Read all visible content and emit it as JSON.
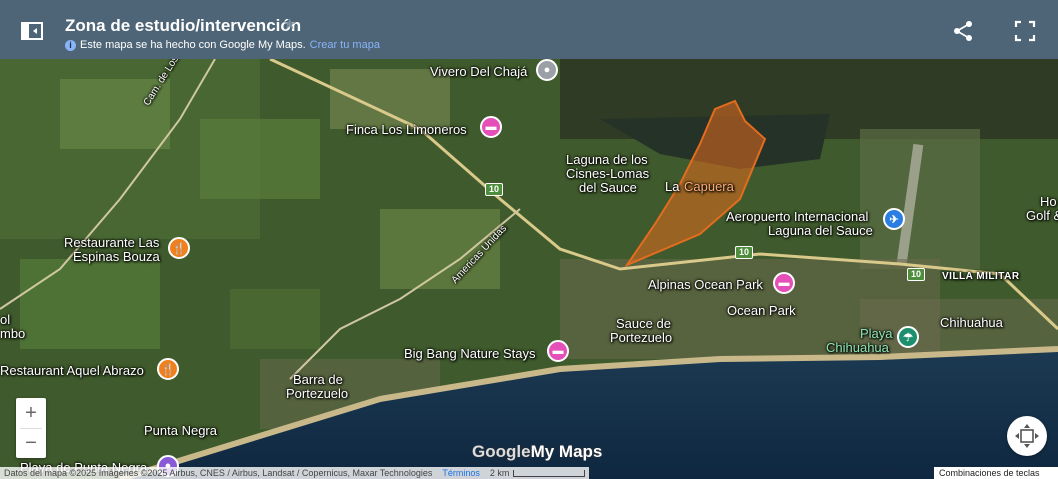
{
  "header": {
    "title": "Zona de estudio/intervención",
    "subtitle": "Este mapa se ha hecho con Google My Maps.",
    "create_link": "Crear tu mapa"
  },
  "places": {
    "vivero": "Vivero Del Chajá",
    "finca": "Finca Los Limoneros",
    "laguna_line1": "Laguna de los",
    "laguna_line2": "Cisnes-Lomas",
    "laguna_line3": "del Sauce",
    "la": "La",
    "capuera": "Capuera",
    "aero_line1": "Aeropuerto Internacional",
    "aero_line2": "Laguna del Sauce",
    "ho_line1": "Ho",
    "ho_line2": "Golf &",
    "villa_militar": "VILLA MILITAR",
    "alpinas": "Alpinas Ocean Park",
    "ocean_park": "Ocean Park",
    "sauce_line1": "Sauce de",
    "sauce_line2": "Portezuelo",
    "playa_line1": "Playa",
    "playa_line2": "Chihuahua",
    "chihuahua": "Chihuahua",
    "restaurante_las_line1": "Restaurante Las",
    "restaurante_las_line2": "Espinas Bouza",
    "big_bang": "Big Bang Nature Stays",
    "restaurant_aquel": "Restaurant Aquel Abrazo",
    "barra_line1": "Barra de",
    "barra_line2": "Portezuelo",
    "punta_negra": "Punta Negra",
    "playa_punta_negra": "Playa de Punta Negra",
    "cam_arrayanes": "Cam. de Los Arrayanes",
    "americas_unidas": "Americas Unidas",
    "left_line1": "ol",
    "left_line2": "mbo",
    "route_10": "10"
  },
  "attribution": {
    "data": "Datos del mapa ©2025 Imágenes ©2025 Airbus, CNES / Airbus, Landsat / Copernicus, Maxar Technologies",
    "terms": "Términos",
    "scale": "2 km",
    "keys": "Combinaciones de teclas"
  },
  "logo": {
    "google": "Google",
    "mymaps": "My Maps"
  },
  "zoom": {
    "in": "+",
    "out": "−"
  },
  "icons": [
    "sidebar-toggle-icon",
    "star-icon",
    "info-icon",
    "share-icon",
    "fullscreen-icon",
    "locate-icon"
  ],
  "colors": {
    "header": "#4e6577",
    "polygon": "#e36c1f",
    "link": "#8ab4f8"
  }
}
